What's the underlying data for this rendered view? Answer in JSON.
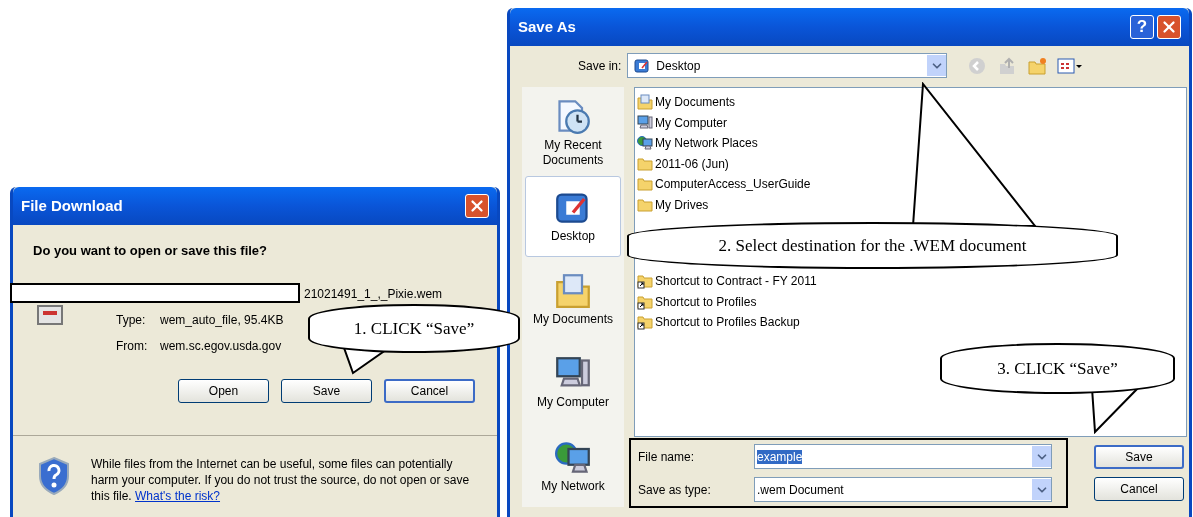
{
  "file_download": {
    "title": "File Download",
    "question": "Do you want to open or save this file?",
    "file_name": "21021491_1_,_Pixie.wem",
    "type_label": "Type:",
    "type_value": "wem_auto_file, 95.4KB",
    "from_label": "From:",
    "from_value": "wem.sc.egov.usda.gov",
    "buttons": [
      {
        "label": "Open",
        "default": false
      },
      {
        "label": "Save",
        "default": false
      },
      {
        "label": "Cancel",
        "default": true
      }
    ],
    "warning": "While files from the Internet can be useful, some files can potentially harm your computer. If you do not trust the source, do not open or save this file.",
    "risk_link": "What's the risk?"
  },
  "save_as": {
    "title": "Save As",
    "help_button": "?",
    "save_in_label": "Save in:",
    "save_in_value": "Desktop",
    "places": [
      {
        "label": "My Recent Documents",
        "kind": "recent",
        "selected": false
      },
      {
        "label": "Desktop",
        "kind": "desktop",
        "selected": true
      },
      {
        "label": "My Documents",
        "kind": "documents",
        "selected": false
      },
      {
        "label": "My Computer",
        "kind": "computer",
        "selected": false
      },
      {
        "label": "My Network",
        "kind": "network",
        "selected": false
      }
    ],
    "files": [
      {
        "name": "My Documents",
        "kind": "documents"
      },
      {
        "name": "My Computer",
        "kind": "computer"
      },
      {
        "name": "My Network Places",
        "kind": "network"
      },
      {
        "name": "2011-06 (Jun)",
        "kind": "folder"
      },
      {
        "name": "ComputerAccess_UserGuide",
        "kind": "folder"
      },
      {
        "name": "My Drives",
        "kind": "folder"
      },
      {
        "name": "Shortcut to Contract - FY 2011",
        "kind": "shortcut"
      },
      {
        "name": "Shortcut to Profiles",
        "kind": "shortcut"
      },
      {
        "name": "Shortcut to Profiles Backup",
        "kind": "shortcut"
      }
    ],
    "file_name_label": "File name:",
    "file_name_value": "example",
    "file_name_selected": true,
    "save_type_label": "Save as type:",
    "save_type_value": ".wem Document",
    "buttons": [
      {
        "label": "Save",
        "default": true
      },
      {
        "label": "Cancel",
        "default": false
      }
    ]
  },
  "callouts": [
    "1. CLICK “Save”",
    "2. Select destination for the .WEM document",
    "3. CLICK “Save”"
  ]
}
